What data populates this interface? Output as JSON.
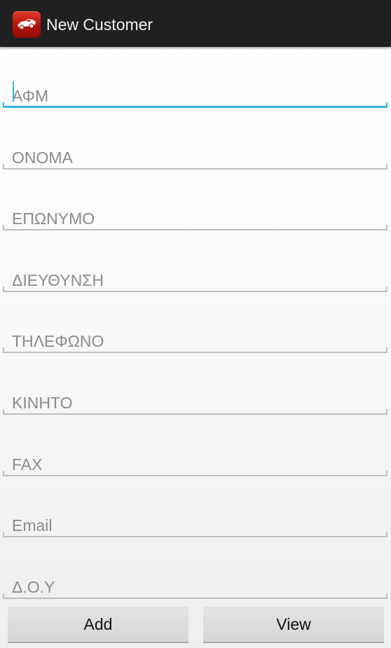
{
  "app": {
    "title": "New Customer",
    "icon": "car-icon"
  },
  "form": {
    "fields": [
      {
        "key": "afm",
        "placeholder": "ΑΦΜ",
        "value": "",
        "focused": true
      },
      {
        "key": "onoma",
        "placeholder": "ΟΝΟΜΑ",
        "value": ""
      },
      {
        "key": "eponymo",
        "placeholder": "ΕΠΩΝΥΜΟ",
        "value": ""
      },
      {
        "key": "dieythynsi",
        "placeholder": "ΔΙΕΥΘΥΝΣΗ",
        "value": ""
      },
      {
        "key": "tilefono",
        "placeholder": "ΤΗΛΕΦΩΝΟ",
        "value": ""
      },
      {
        "key": "kinito",
        "placeholder": "ΚΙΝΗΤΟ",
        "value": ""
      },
      {
        "key": "fax",
        "placeholder": "FAX",
        "value": ""
      },
      {
        "key": "email",
        "placeholder": "Email",
        "value": ""
      },
      {
        "key": "doy",
        "placeholder": "Δ.Ο.Υ",
        "value": ""
      }
    ]
  },
  "buttons": {
    "add_label": "Add",
    "view_label": "View"
  },
  "colors": {
    "action_bar": "#202020",
    "accent_focus": "#33b5e5",
    "underline": "#bfbfbf",
    "placeholder": "#8c8c8c",
    "button": "#d9d9d9",
    "icon_red": "#c4180e"
  }
}
